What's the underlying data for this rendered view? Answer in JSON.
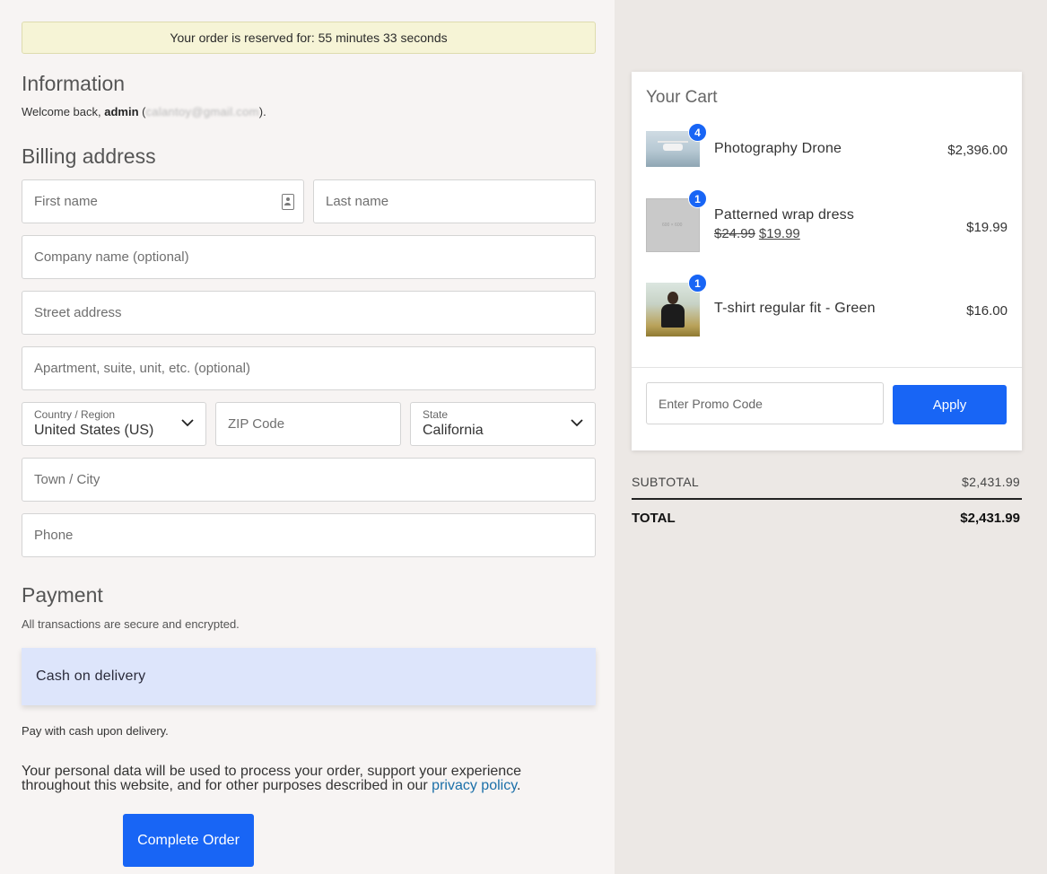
{
  "reservation": {
    "text": "Your order is reserved for:",
    "time": "55 minutes 33 seconds"
  },
  "information": {
    "title": "Information",
    "welcome_prefix": "Welcome back, ",
    "username": "admin",
    "email_blurred": "calantoy@gmail.com"
  },
  "billing": {
    "title": "Billing address",
    "first_name_placeholder": "First name",
    "last_name_placeholder": "Last name",
    "company_placeholder": "Company name (optional)",
    "street_placeholder": "Street address",
    "apartment_placeholder": "Apartment, suite, unit, etc. (optional)",
    "country_label": "Country / Region",
    "country_value": "United States (US)",
    "zip_placeholder": "ZIP Code",
    "state_label": "State",
    "state_value": "California",
    "city_placeholder": "Town / City",
    "phone_placeholder": "Phone"
  },
  "payment": {
    "title": "Payment",
    "secure_note": "All transactions are secure and encrypted.",
    "method": "Cash on delivery",
    "method_note": "Pay with cash upon delivery."
  },
  "privacy": {
    "text": "Your personal data will be used to process your order, support your experience throughout this website, and for other purposes described in our ",
    "link": "privacy policy",
    "suffix": "."
  },
  "complete_button": "Complete Order",
  "cart": {
    "title": "Your Cart",
    "items": [
      {
        "name": "Photography Drone",
        "qty": "4",
        "total": "$2,396.00"
      },
      {
        "name": "Patterned wrap dress",
        "qty": "1",
        "old_price": "$24.99",
        "new_price": "$19.99",
        "total": "$19.99",
        "placeholder_text": "600 × 600"
      },
      {
        "name": "T-shirt regular fit - Green",
        "qty": "1",
        "total": "$16.00"
      }
    ],
    "promo_placeholder": "Enter Promo Code",
    "apply_label": "Apply"
  },
  "summary": {
    "subtotal_label": "SUBTOTAL",
    "subtotal_value": "$2,431.99",
    "total_label": "TOTAL",
    "total_value": "$2,431.99"
  },
  "colors": {
    "accent": "#1865f5",
    "reserve_bg": "#f6f4d6",
    "payment_bg": "#dde5fb",
    "link": "#1b6fa8"
  }
}
